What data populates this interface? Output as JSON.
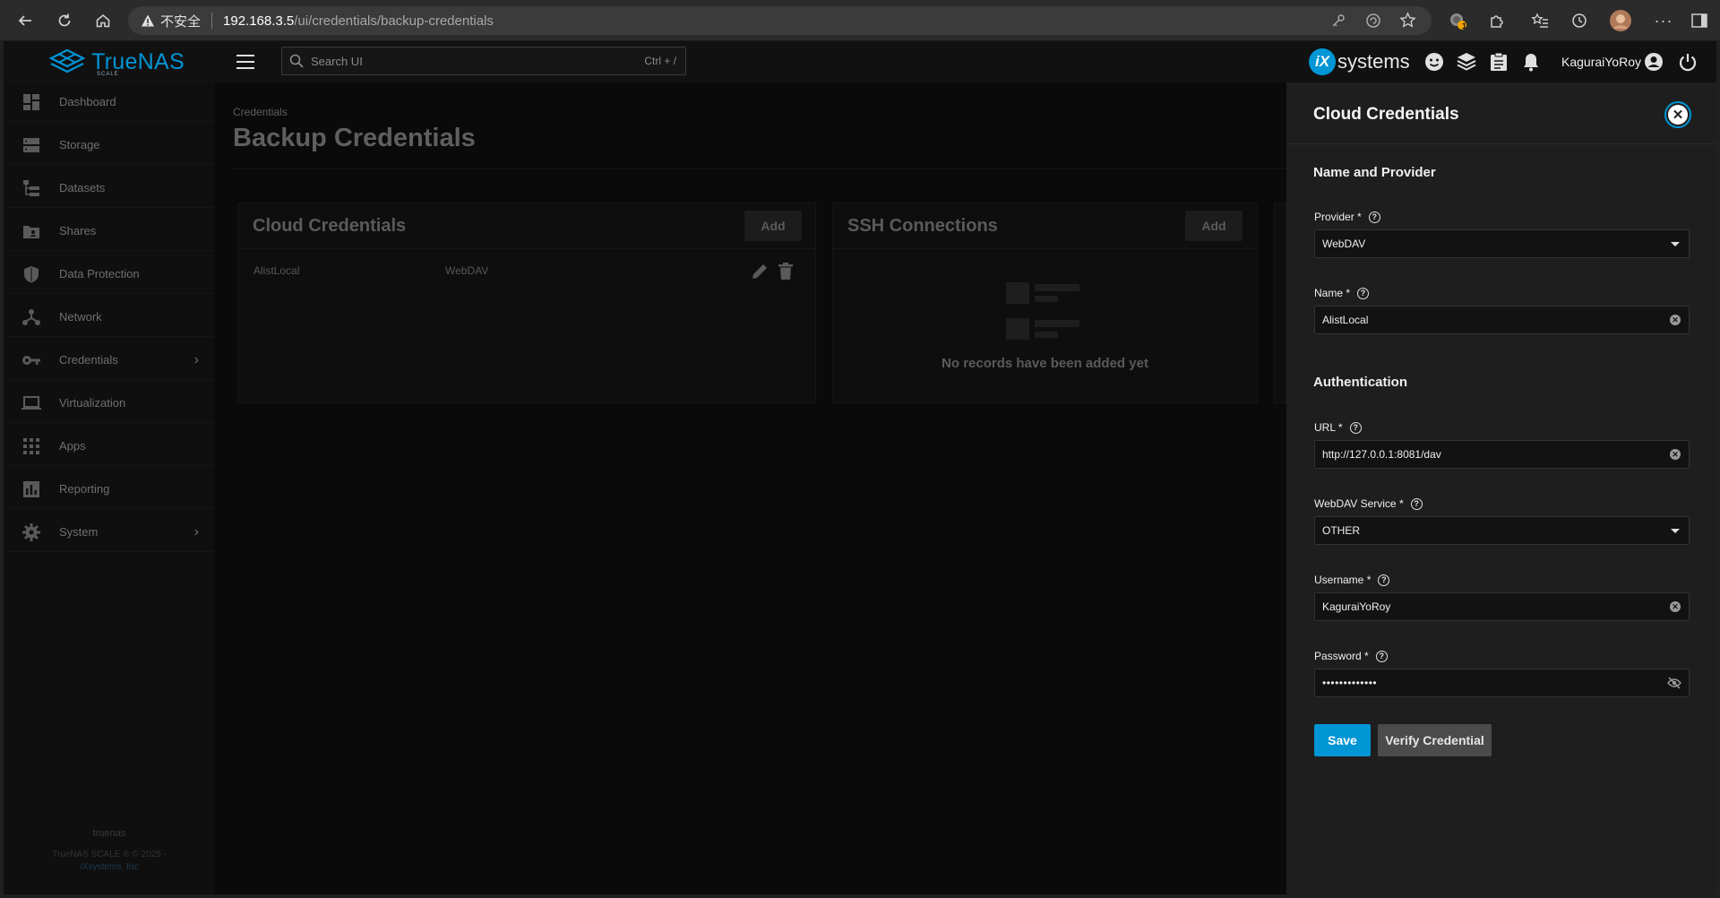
{
  "browser": {
    "security_label": "不安全",
    "url_host": "192.168.3.5",
    "url_path": "/ui/credentials/backup-credentials",
    "extension_badge": "1"
  },
  "header": {
    "brand": "TrueNAS",
    "brand_sub": "SCALE",
    "search_placeholder": "Search UI",
    "search_shortcut": "Ctrl + /",
    "vendor_prefix": "iX",
    "vendor_name": "systems",
    "username": "KaguraiYoRoy"
  },
  "sidebar": {
    "items": [
      {
        "label": "Dashboard",
        "icon": "dashboard-icon"
      },
      {
        "label": "Storage",
        "icon": "storage-icon"
      },
      {
        "label": "Datasets",
        "icon": "datasets-icon"
      },
      {
        "label": "Shares",
        "icon": "shares-icon"
      },
      {
        "label": "Data Protection",
        "icon": "shield-icon"
      },
      {
        "label": "Network",
        "icon": "network-icon"
      },
      {
        "label": "Credentials",
        "icon": "key-icon",
        "chevron": true
      },
      {
        "label": "Virtualization",
        "icon": "laptop-icon"
      },
      {
        "label": "Apps",
        "icon": "apps-grid-icon"
      },
      {
        "label": "Reporting",
        "icon": "reporting-icon"
      },
      {
        "label": "System",
        "icon": "gear-icon",
        "chevron": true
      }
    ],
    "footer_hostname": "truenas",
    "footer_copyright": "TrueNAS SCALE ® © 2025 -",
    "footer_link": "iXsystems, Inc"
  },
  "main": {
    "breadcrumb": "Credentials",
    "title": "Backup Credentials",
    "cloud_card": {
      "title": "Cloud Credentials",
      "add_label": "Add",
      "rows": [
        {
          "name": "AlistLocal",
          "provider": "WebDAV"
        }
      ]
    },
    "ssh_card": {
      "title": "SSH Connections",
      "add_label": "Add",
      "empty_text": "No records have been added yet"
    }
  },
  "panel": {
    "title": "Cloud Credentials",
    "section_name_provider": "Name and Provider",
    "provider": {
      "label": "Provider",
      "required": "*",
      "value": "WebDAV"
    },
    "name": {
      "label": "Name",
      "required": "*",
      "value": "AlistLocal"
    },
    "section_auth": "Authentication",
    "url": {
      "label": "URL",
      "required": "*",
      "value": "http://127.0.0.1:8081/dav"
    },
    "webdav_service": {
      "label": "WebDAV Service",
      "required": "*",
      "value": "OTHER"
    },
    "username": {
      "label": "Username",
      "required": "*",
      "value": "KaguraiYoRoy"
    },
    "password": {
      "label": "Password",
      "required": "*",
      "value": "•••••••••••••"
    },
    "save_label": "Save",
    "verify_label": "Verify Credential"
  },
  "colors": {
    "accent": "#0095d5",
    "panel_bg": "#1e1e1e",
    "overlay_dim": "#0a0a0a"
  }
}
